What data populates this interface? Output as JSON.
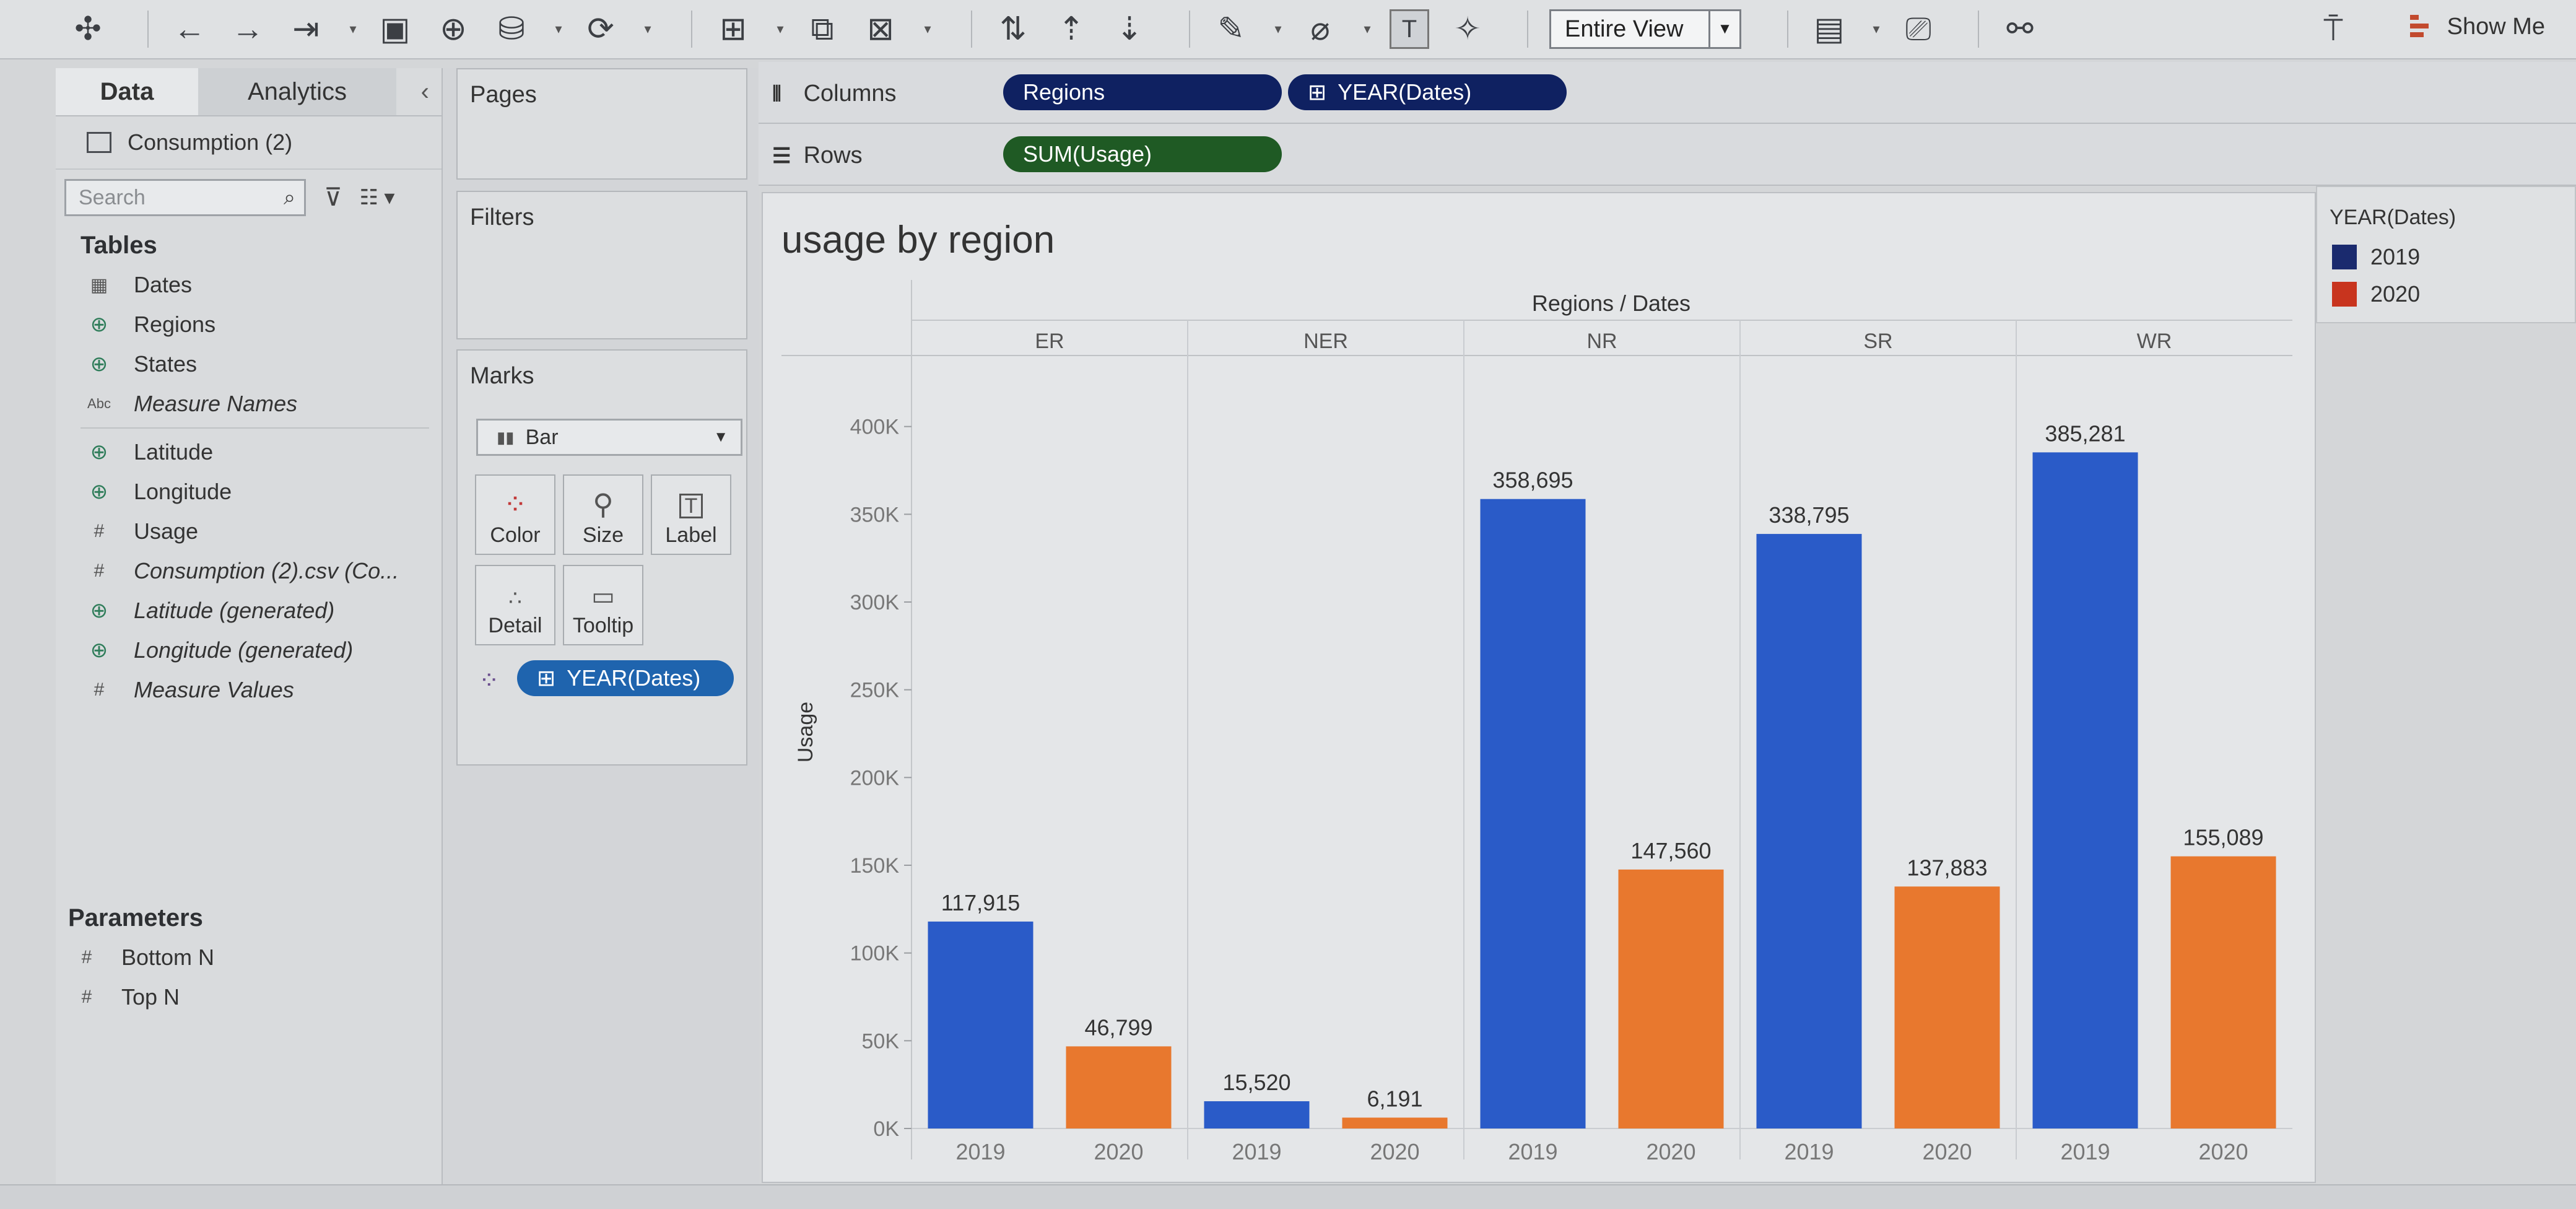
{
  "toolbar": {
    "view_mode": "Entire View",
    "show_me": "Show Me"
  },
  "data_pane": {
    "tabs": [
      "Data",
      "Analytics"
    ],
    "data_source": "Consumption (2)",
    "search_placeholder": "Search",
    "tables_header": "Tables",
    "fields": [
      {
        "label": "Dates",
        "icon": "calendar-icon"
      },
      {
        "label": "Regions",
        "icon": "globe-icon"
      },
      {
        "label": "States",
        "icon": "globe-icon"
      },
      {
        "label": "Measure Names",
        "icon": "abc-icon"
      },
      {
        "label": "Latitude",
        "icon": "globe-icon"
      },
      {
        "label": "Longitude",
        "icon": "globe-icon"
      },
      {
        "label": "Usage",
        "icon": "hash-icon"
      },
      {
        "label": "Consumption (2).csv (Co...",
        "icon": "hash-icon"
      },
      {
        "label": "Latitude (generated)",
        "icon": "globe-icon"
      },
      {
        "label": "Longitude (generated)",
        "icon": "globe-icon"
      },
      {
        "label": "Measure Values",
        "icon": "hash-icon"
      }
    ],
    "parameters_header": "Parameters",
    "parameters": [
      "Bottom N",
      "Top N"
    ]
  },
  "cards": {
    "pages": "Pages",
    "filters": "Filters",
    "marks": "Marks",
    "mark_type": "Bar",
    "buttons": [
      "Color",
      "Size",
      "Label",
      "Detail",
      "Tooltip"
    ],
    "color_pill": "YEAR(Dates)"
  },
  "shelves": {
    "columns_label": "Columns",
    "rows_label": "Rows",
    "columns_pills": [
      "Regions",
      "YEAR(Dates)"
    ],
    "rows_pills": [
      "SUM(Usage)"
    ]
  },
  "legend": {
    "title": "YEAR(Dates)",
    "items": [
      {
        "label": "2019",
        "color": "#1a2a6e"
      },
      {
        "label": "2020",
        "color": "#c8341e"
      }
    ]
  },
  "colors": {
    "bar_2019": "#2a5bc8",
    "bar_2020": "#e8782e",
    "dim_pill": "#0f2161",
    "measure_pill": "#1f5a24"
  },
  "chart_data": {
    "type": "bar",
    "title": "usage by region",
    "header": "Regions / Dates",
    "ylabel": "Usage",
    "ylim": [
      0,
      420000
    ],
    "yticks": [
      "0K",
      "50K",
      "100K",
      "150K",
      "200K",
      "250K",
      "300K",
      "350K",
      "400K"
    ],
    "groups": [
      {
        "region": "ER",
        "bars": [
          {
            "year": "2019",
            "value": 117915,
            "label": "117,915"
          },
          {
            "year": "2020",
            "value": 46799,
            "label": "46,799"
          }
        ]
      },
      {
        "region": "NER",
        "bars": [
          {
            "year": "2019",
            "value": 15520,
            "label": "15,520"
          },
          {
            "year": "2020",
            "value": 6191,
            "label": "6,191"
          }
        ]
      },
      {
        "region": "NR",
        "bars": [
          {
            "year": "2019",
            "value": 358695,
            "label": "358,695"
          },
          {
            "year": "2020",
            "value": 147560,
            "label": "147,560"
          }
        ]
      },
      {
        "region": "SR",
        "bars": [
          {
            "year": "2019",
            "value": 338795,
            "label": "338,795"
          },
          {
            "year": "2020",
            "value": 137883,
            "label": "137,883"
          }
        ]
      },
      {
        "region": "WR",
        "bars": [
          {
            "year": "2019",
            "value": 385281,
            "label": "385,281"
          },
          {
            "year": "2020",
            "value": 155089,
            "label": "155,089"
          }
        ]
      }
    ]
  }
}
